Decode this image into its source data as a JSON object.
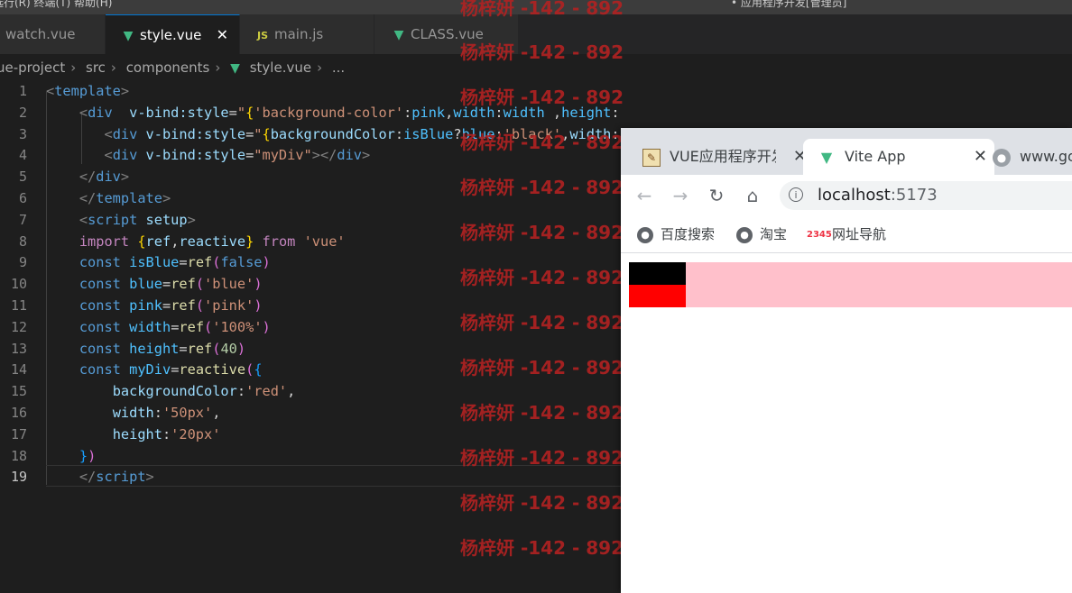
{
  "menubar": {
    "left_text": "选行(R)  终端(T)  帮助(H)",
    "right_text": "• 应用程序开发[管理员]"
  },
  "tabs": [
    {
      "label": "watch.vue",
      "icon": "vue-icon"
    },
    {
      "label": "style.vue",
      "icon": "vue-icon",
      "active": true
    },
    {
      "label": "main.js",
      "icon": "js-icon"
    },
    {
      "label": "CLASS.vue",
      "icon": "vue-icon"
    }
  ],
  "breadcrumb": [
    "ue-project",
    "src",
    "components",
    "style.vue",
    "..."
  ],
  "line_numbers": [
    "1",
    "2",
    "3",
    "4",
    "5",
    "6",
    "7",
    "8",
    "9",
    "10",
    "11",
    "12",
    "13",
    "14",
    "15",
    "16",
    "17",
    "18",
    "19"
  ],
  "watermark": "杨梓妍 -142 - 892",
  "browser": {
    "tabs": [
      "VUE应用程序开发",
      "Vite App",
      "www.go"
    ],
    "url_host": "localhost",
    "url_port": ":5173",
    "bookmarks": [
      "百度搜索",
      "淘宝",
      "网址导航"
    ]
  },
  "colors": {
    "pink": "#ffc0cb",
    "black": "#000000",
    "red": "#ff0000",
    "vue_green": "#41b883"
  }
}
